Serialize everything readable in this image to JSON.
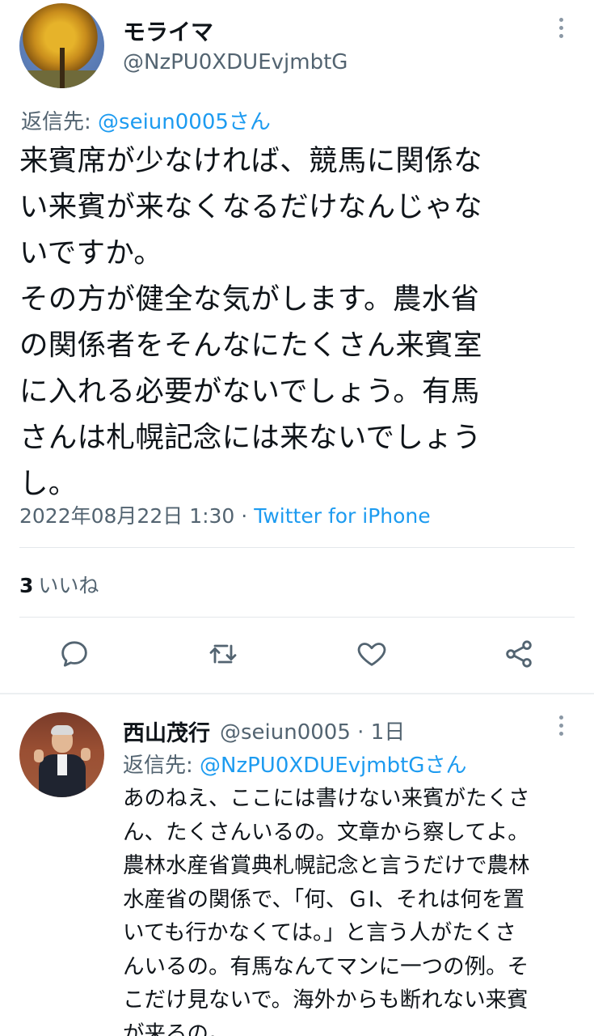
{
  "tweet": {
    "author_name": "モライマ",
    "author_handle": "@NzPU0XDUEvjmbtG",
    "reply_prefix": "返信先:",
    "reply_mention": "@seiun0005さん",
    "body_lines": [
      "来賓席が少なければ、競馬に関係な",
      "い来賓が来なくなるだけなんじゃな",
      "いですか。",
      "その方が健全な気がします。農水省",
      "の関係者をそんなにたくさん来賓室",
      "に入れる必要がないでしょう。有馬",
      "さんは札幌記念には来ないでしょう",
      "し。"
    ],
    "timestamp": "2022年08月22日 1:30",
    "separator": "·",
    "source": "Twitter for iPhone",
    "like_count": "3",
    "like_label": "いいね",
    "avatar_icon": "ginkgo-tree-avatar"
  },
  "actions": {
    "reply_icon": "reply-icon",
    "retweet_icon": "retweet-icon",
    "like_icon": "heart-icon",
    "share_icon": "share-icon",
    "icon_color": "#536471"
  },
  "reply": {
    "author_name": "西山茂行",
    "author_handle": "@seiun0005",
    "separator": "·",
    "age": "1日",
    "reply_prefix": "返信先:",
    "reply_mention": "@NzPU0XDUEvjmbtGさん",
    "body_lines": [
      "あのねえ、ここには書けない来賓がたくさ",
      "ん、たくさんいるの。文章から察してよ。",
      "農林水産省賞典札幌記念と言うだけで農林",
      "水産省の関係で、「何、ＧⅠ、それは何を置",
      "いても行かなくては。」と言う人がたくさ",
      "んいるの。有馬なんてマンに一つの例。そ",
      "こだけ見ないで。海外からも断れない来賓",
      "が来るの。"
    ],
    "avatar_icon": "person-avatar"
  },
  "colors": {
    "link": "#1d9bf0",
    "secondary_text": "#536471",
    "primary_text": "#0f1419",
    "divider": "#e4e8eb"
  }
}
